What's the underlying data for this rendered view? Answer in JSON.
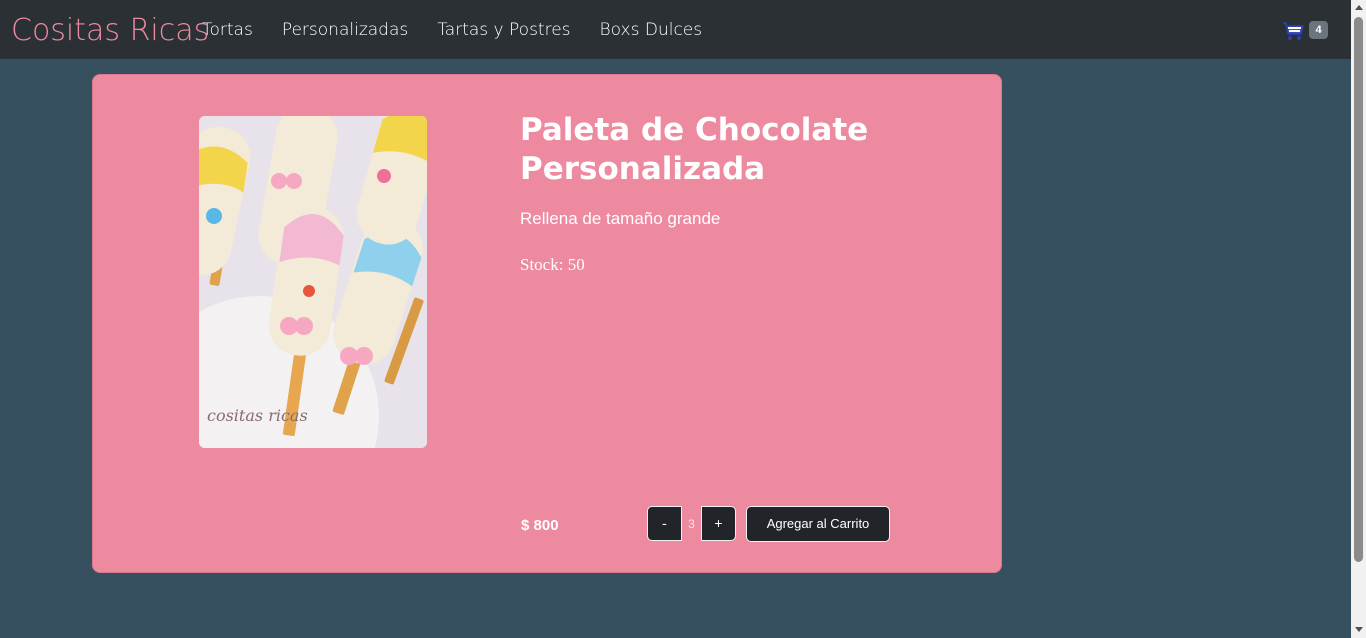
{
  "navbar": {
    "brand": "Cositas Ricas",
    "links": [
      "Tortas",
      "Personalizadas",
      "Tartas y Postres",
      "Boxs Dulces"
    ],
    "cart_icon": "cart-icon",
    "cart_count": "4"
  },
  "product": {
    "image_icon": "cake-pop-photo",
    "title": "Paleta de Chocolate Personalizada",
    "description": "Rellena de tamaño grande",
    "stock": "Stock: 50",
    "price": "$ 800",
    "quantity": "3",
    "minus_label": "-",
    "plus_label": "+",
    "add_to_cart_label": "Agregar al Carrito"
  },
  "colors": {
    "background": "#36505f",
    "navbar": "#2b3035",
    "brand": "#ee8aa0",
    "card": "#ee8aa0",
    "button": "#212529",
    "badge": "#6c757d"
  }
}
